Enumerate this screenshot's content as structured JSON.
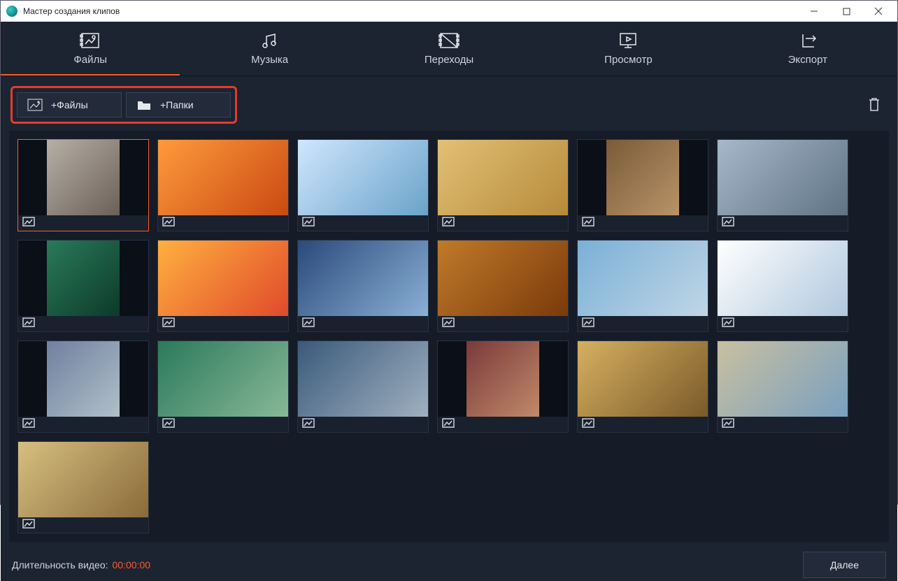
{
  "window": {
    "title": "Мастер создания клипов"
  },
  "tabs": {
    "files": "Файлы",
    "music": "Музыка",
    "trans": "Переходы",
    "preview": "Просмотр",
    "export": "Экспорт"
  },
  "toolbar": {
    "add_files": "+Файлы",
    "add_folders": "+Папки"
  },
  "thumbs": [
    {
      "icon": "image",
      "sel": true,
      "orient": "portrait",
      "grad": "g1"
    },
    {
      "icon": "image",
      "sel": false,
      "orient": "landscape",
      "grad": "g2"
    },
    {
      "icon": "image",
      "sel": false,
      "orient": "landscape",
      "grad": "g3"
    },
    {
      "icon": "image",
      "sel": false,
      "orient": "landscape",
      "grad": "g4"
    },
    {
      "icon": "image",
      "sel": false,
      "orient": "portrait",
      "grad": "g5"
    },
    {
      "icon": "image",
      "sel": false,
      "orient": "landscape",
      "grad": "g6"
    },
    {
      "icon": "image",
      "sel": false,
      "orient": "portrait",
      "grad": "g7"
    },
    {
      "icon": "image",
      "sel": false,
      "orient": "landscape",
      "grad": "g8"
    },
    {
      "icon": "image",
      "sel": false,
      "orient": "landscape",
      "grad": "g9"
    },
    {
      "icon": "image",
      "sel": false,
      "orient": "landscape",
      "grad": "g10"
    },
    {
      "icon": "image",
      "sel": false,
      "orient": "landscape",
      "grad": "g11"
    },
    {
      "icon": "image",
      "sel": false,
      "orient": "landscape",
      "grad": "g12"
    },
    {
      "icon": "image",
      "sel": false,
      "orient": "portrait",
      "grad": "g13"
    },
    {
      "icon": "image",
      "sel": false,
      "orient": "landscape",
      "grad": "g14"
    },
    {
      "icon": "image",
      "sel": false,
      "orient": "landscape",
      "grad": "g15"
    },
    {
      "icon": "image",
      "sel": false,
      "orient": "portrait",
      "grad": "g16"
    },
    {
      "icon": "image",
      "sel": false,
      "orient": "landscape",
      "grad": "g17"
    },
    {
      "icon": "image",
      "sel": false,
      "orient": "landscape",
      "grad": "g18"
    },
    {
      "icon": "image",
      "sel": false,
      "orient": "landscape",
      "grad": "g19"
    }
  ],
  "footer": {
    "duration_label": "Длительность видео:",
    "duration_value": "00:00:00",
    "next": "Далее"
  },
  "colors": {
    "accent": "#ff5a2b",
    "highlight_box": "#e53a2e"
  }
}
